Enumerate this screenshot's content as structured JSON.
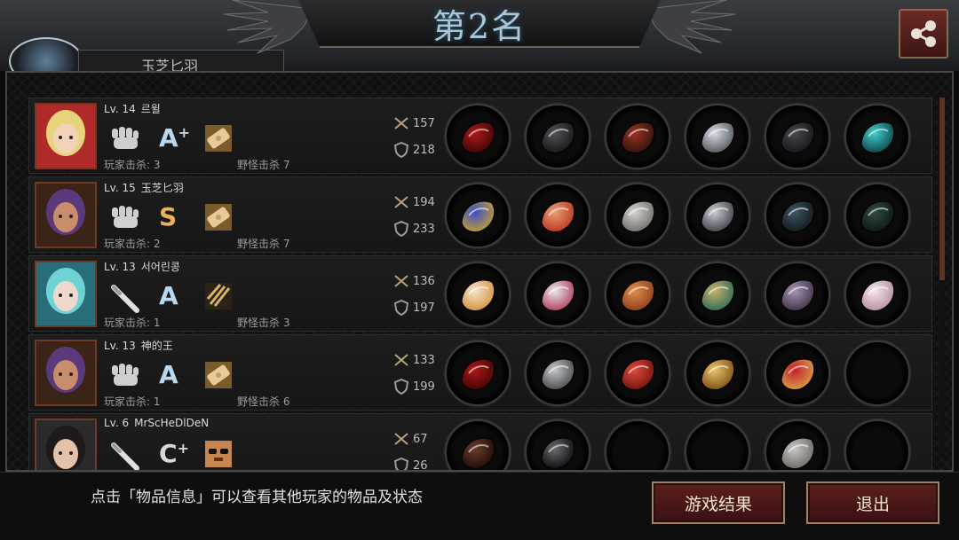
{
  "header": {
    "rank_title": "第2名",
    "behind_name": "玉芝匕羽"
  },
  "players": [
    {
      "level": "Lv. 14",
      "name": "르윌",
      "grade": "A",
      "grade_plus": "+",
      "grade_color": "#b9d8ee",
      "player_kills": "玩家击杀: 3",
      "monster_kills": "野怪击杀 7",
      "attack": "157",
      "defense": "218",
      "portrait": "blonde-girl-portrait",
      "ability_icon": "fist-icon",
      "skill_icon": "bandage-icon",
      "items": [
        "red-claw-icon",
        "black-helmet-icon",
        "red-armor-icon",
        "silver-blade-icon",
        "black-boots-icon",
        "teal-eye-icon"
      ]
    },
    {
      "level": "Lv. 15",
      "name": "玉芝匕羽",
      "grade": "S",
      "grade_plus": "",
      "grade_color": "#e8b15a",
      "player_kills": "玩家击杀: 2",
      "monster_kills": "野怪击杀 7",
      "attack": "194",
      "defense": "233",
      "portrait": "hooded-man-portrait",
      "ability_icon": "fist-icon",
      "skill_icon": "bandage-icon",
      "items": [
        "blue-gauntlet-icon",
        "winged-tiara-icon",
        "silver-armor-icon",
        "steel-disc-icon",
        "dark-boots-icon",
        "scope-icon"
      ]
    },
    {
      "level": "Lv. 13",
      "name": "서어린콩",
      "grade": "A",
      "grade_plus": "",
      "grade_color": "#b9d8ee",
      "player_kills": "玩家击杀: 1",
      "monster_kills": "野怪击杀 3",
      "attack": "136",
      "defense": "197",
      "portrait": "teal-hair-girl-portrait",
      "ability_icon": "bat-icon",
      "skill_icon": "claw-scratch-icon",
      "items": [
        "feather-fan-icon",
        "pink-mask-icon",
        "scale-armor-icon",
        "jade-bracelet-icon",
        "purple-boots-icon",
        "pearl-icon"
      ]
    },
    {
      "level": "Lv. 13",
      "name": "神的王",
      "grade": "A",
      "grade_plus": "",
      "grade_color": "#b9d8ee",
      "player_kills": "玩家击杀: 1",
      "monster_kills": "野怪击杀 6",
      "attack": "133",
      "defense": "199",
      "portrait": "hooded-man-portrait",
      "ability_icon": "fist-icon",
      "skill_icon": "bandage-icon",
      "items": [
        "red-claw-icon",
        "knight-helmet-icon",
        "red-cloak-icon",
        "gold-shield-icon",
        "red-heels-icon",
        "empty-slot"
      ]
    },
    {
      "level": "Lv. 6",
      "name": "MrScHeDlDeN",
      "grade": "C",
      "grade_plus": "+",
      "grade_color": "#d8d8d8",
      "player_kills": "",
      "monster_kills": "",
      "attack": "67",
      "defense": "26",
      "portrait": "glasses-woman-portrait",
      "ability_icon": "bat-icon",
      "skill_icon": "sunglasses-face-icon",
      "items": [
        "whip-icon",
        "black-headband-icon",
        "empty-slot",
        "empty-slot",
        "slippers-icon",
        "empty-slot"
      ]
    }
  ],
  "footer": {
    "hint": "点击「物品信息」可以查看其他玩家的物品及状态",
    "result_button": "游戏结果",
    "exit_button": "退出"
  },
  "colors": {
    "accent_red": "#5a1f1b",
    "button_border": "#9d8365",
    "rank_title": "#a8c6d8"
  }
}
